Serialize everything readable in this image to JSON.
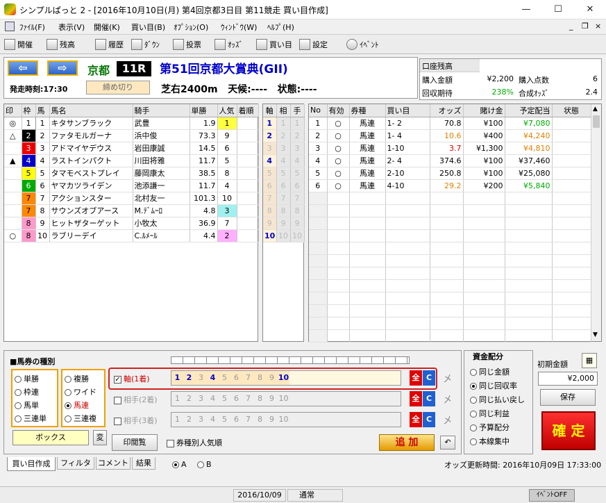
{
  "window": {
    "title": "シンプルぱっと 2 - [2016年10月10日(月) 第4回京都3日目 第11競走 買い目作成]",
    "min": "—",
    "max": "☐",
    "close": "✕"
  },
  "menu": [
    "ﾌｧｲﾙ(F)",
    "表示(V)",
    "開催(K)",
    "買い目(B)",
    "ｵﾌﾟｼｮﾝ(O)",
    "ｳｨﾝﾄﾞｳ(W)",
    "ﾍﾙﾌﾟ(H)"
  ],
  "toolbar": [
    "開催",
    "残高",
    "履歴",
    "ﾀﾞｳﾝ",
    "投票",
    "ｵｯｽﾞ",
    "買い目",
    "設定",
    "ｲﾍﾞﾝﾄ"
  ],
  "race": {
    "venue": "京都",
    "number": "11R",
    "start_label": "発走時刻:",
    "start_time": "17:30",
    "status": "締め切り",
    "name": "第51回京都大賞典(GII)",
    "course": "芝右2400m",
    "weather_label": "天候:",
    "weather": "----",
    "condition_label": "状態:",
    "condition": "----"
  },
  "summary": {
    "balance_label": "口座残高",
    "balance": "",
    "buy_amount_label": "購入金額",
    "buy_amount": "¥2,200",
    "buy_count_label": "購入点数",
    "buy_count": "6",
    "expect_label": "回収期待",
    "expect": "238%",
    "synth_label": "合成ｵｯｽﾞ",
    "synth": "2.4"
  },
  "horse_headers": [
    "印",
    "枠",
    "馬",
    "馬名",
    "騎手",
    "単勝",
    "人気",
    "着順"
  ],
  "horses": [
    {
      "mark": "◎",
      "waku": "1",
      "num": "1",
      "name": "キタサンブラック",
      "jockey": "武豊",
      "odds": "1.9",
      "pop": "1"
    },
    {
      "mark": "△",
      "waku": "2",
      "num": "2",
      "name": "ファタモルガーナ",
      "jockey": "浜中俊",
      "odds": "73.3",
      "pop": "9"
    },
    {
      "mark": "",
      "waku": "3",
      "num": "3",
      "name": "アドマイヤデウス",
      "jockey": "岩田康誠",
      "odds": "14.5",
      "pop": "6"
    },
    {
      "mark": "▲",
      "waku": "4",
      "num": "4",
      "name": "ラストインパクト",
      "jockey": "川田将雅",
      "odds": "11.7",
      "pop": "5"
    },
    {
      "mark": "",
      "waku": "5",
      "num": "5",
      "name": "タマモベストプレイ",
      "jockey": "藤岡康太",
      "odds": "38.5",
      "pop": "8"
    },
    {
      "mark": "",
      "waku": "6",
      "num": "6",
      "name": "ヤマカツライデン",
      "jockey": "池添謙一",
      "odds": "11.7",
      "pop": "4"
    },
    {
      "mark": "",
      "waku": "7",
      "num": "7",
      "name": "アクションスター",
      "jockey": "北村友一",
      "odds": "101.3",
      "pop": "10"
    },
    {
      "mark": "",
      "waku": "7",
      "num": "8",
      "name": "サウンズオブアース",
      "jockey": "M.ﾃﾞﾑｰﾛ",
      "odds": "4.8",
      "pop": "3"
    },
    {
      "mark": "",
      "waku": "8",
      "num": "9",
      "name": "ヒットザターゲット",
      "jockey": "小牧太",
      "odds": "36.9",
      "pop": "7"
    },
    {
      "mark": "○",
      "waku": "8",
      "num": "10",
      "name": "ラブリーデイ",
      "jockey": "C.ﾙﾒｰﾙ",
      "odds": "4.4",
      "pop": "2"
    }
  ],
  "axis_headers": [
    "軸",
    "相",
    "手"
  ],
  "axis_rows": [
    "1",
    "2",
    "3",
    "4",
    "5",
    "6",
    "7",
    "8",
    "9",
    "10"
  ],
  "bet_headers": [
    "No",
    "有効",
    "券種",
    "買い目",
    "オッズ",
    "賭け金",
    "予定配当",
    "状態"
  ],
  "bets": [
    {
      "no": "1",
      "valid": "○",
      "type": "馬連",
      "combo": "1- 2",
      "odds": "70.8",
      "stake": "¥100",
      "payout": "¥7,080",
      "oc": "#000",
      "pc": "#0a0"
    },
    {
      "no": "2",
      "valid": "○",
      "type": "馬連",
      "combo": "1- 4",
      "odds": "10.6",
      "stake": "¥400",
      "payout": "¥4,240",
      "oc": "#e08000",
      "pc": "#e08000"
    },
    {
      "no": "3",
      "valid": "○",
      "type": "馬連",
      "combo": "1-10",
      "odds": "3.7",
      "stake": "¥1,300",
      "payout": "¥4,810",
      "oc": "#d00",
      "pc": "#e08000"
    },
    {
      "no": "4",
      "valid": "○",
      "type": "馬連",
      "combo": "2- 4",
      "odds": "374.6",
      "stake": "¥100",
      "payout": "¥37,460",
      "oc": "#000",
      "pc": "#000"
    },
    {
      "no": "5",
      "valid": "○",
      "type": "馬連",
      "combo": "2-10",
      "odds": "250.8",
      "stake": "¥100",
      "payout": "¥25,080",
      "oc": "#000",
      "pc": "#000"
    },
    {
      "no": "6",
      "valid": "○",
      "type": "馬連",
      "combo": "4-10",
      "odds": "29.2",
      "stake": "¥200",
      "payout": "¥5,840",
      "oc": "#e08000",
      "pc": "#0a0"
    }
  ],
  "bettypes": {
    "title": "■馬券の種別",
    "col1": [
      "単勝",
      "枠連",
      "馬単",
      "三連単"
    ],
    "col2": [
      "複勝",
      "ワイド",
      "馬連",
      "三連複"
    ],
    "selected": "馬連",
    "box": "ボックス",
    "change": "変"
  },
  "axisrows": [
    {
      "label": "軸(1着)",
      "checked": true
    },
    {
      "label": "相手(2着)",
      "checked": false
    },
    {
      "label": "相手(3着)",
      "checked": false
    }
  ],
  "nums": [
    "1",
    "2",
    "3",
    "4",
    "5",
    "6",
    "7",
    "8",
    "9",
    "10"
  ],
  "all_btn": "全",
  "c_btn": "C",
  "kanji": "㐅",
  "print_btn": "印閲覧",
  "popularity_chk": "券種別人気順",
  "add_btn": "追 加",
  "alloc": {
    "title": "資金配分",
    "options": [
      "同じ金額",
      "同じ回収率",
      "同じ払い戻し",
      "同じ利益",
      "予算配分",
      "本線集中"
    ],
    "selected": "同じ回収率",
    "init_label": "初期金額",
    "init_value": "¥2,000",
    "save": "保存",
    "confirm": "確 定"
  },
  "tabs": [
    "買い目作成",
    "フィルタ",
    "コメント",
    "結果"
  ],
  "ab": [
    "A",
    "B"
  ],
  "odds_update": "オッズ更新時間: 2016年10月09日  17:33:00",
  "status": {
    "date": "2016/10/09",
    "mode": "通常",
    "event": "ｲﾍﾞﾝﾄOFF"
  }
}
